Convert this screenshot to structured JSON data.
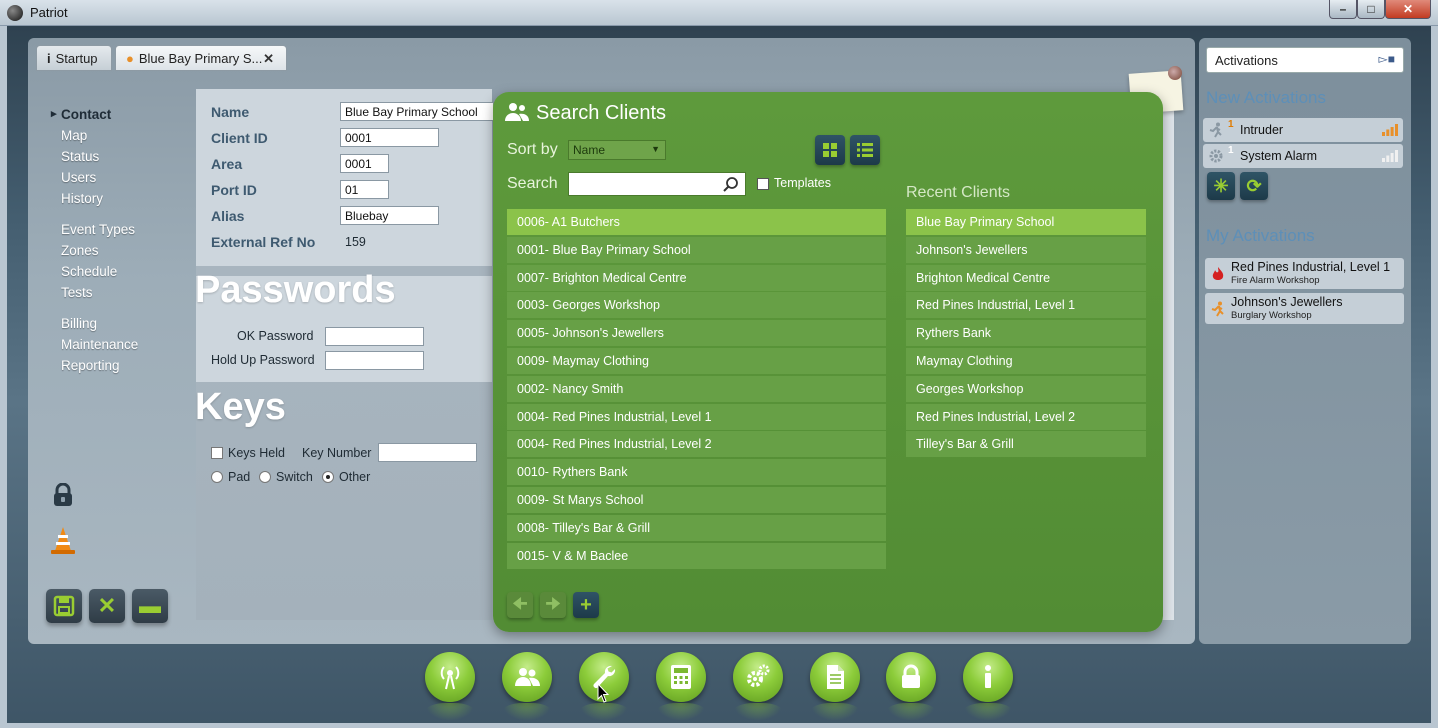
{
  "window": {
    "title": "Patriot",
    "min": "–",
    "max": "□",
    "close": "✕"
  },
  "tabs": [
    {
      "label": "Startup",
      "icon": "info-icon"
    },
    {
      "label": "Blue Bay Primary S...",
      "icon": "user-icon",
      "close": "✕"
    }
  ],
  "nav": {
    "items": [
      "Contact",
      "Map",
      "Status",
      "Users",
      "History",
      "Event Types",
      "Zones",
      "Schedule",
      "Tests",
      "Billing",
      "Maintenance",
      "Reporting"
    ],
    "active": "Contact"
  },
  "client": {
    "name_label": "Name",
    "name_value": "Blue Bay Primary School",
    "id_label": "Client ID",
    "id_value": "0001",
    "area_label": "Area",
    "area_value": "0001",
    "port_label": "Port ID",
    "port_value": "01",
    "alias_label": "Alias",
    "alias_value": "Bluebay",
    "extref_label": "External Ref No",
    "extref_value": "159"
  },
  "passwords": {
    "title": "Passwords",
    "ok_label": "OK Password",
    "holdup_label": "Hold Up Password"
  },
  "keys": {
    "title": "Keys",
    "held_label": "Keys Held",
    "number_label": "Key Number",
    "pad_label": "Pad",
    "switch_label": "Switch",
    "other_label": "Other",
    "selected": "Other"
  },
  "search_clients": {
    "title": "Search Clients",
    "sort_label": "Sort by",
    "sort_value": "Name",
    "search_label": "Search",
    "search_value": "",
    "templates_label": "Templates",
    "results": [
      "0006- A1 Butchers",
      "0001- Blue Bay Primary School",
      "0007- Brighton Medical Centre",
      "0003- Georges Workshop",
      "0005- Johnson's Jewellers",
      "0009- Maymay Clothing",
      "0002- Nancy Smith",
      "0004- Red Pines Industrial, Level 1",
      "0004- Red Pines Industrial, Level 2",
      "0010- Rythers Bank",
      "0009- St Marys School",
      "0008- Tilley's Bar & Grill",
      "0015- V & M Baclee"
    ],
    "selected_result": 0,
    "recent_title": "Recent Clients",
    "recent": [
      "Blue Bay Primary School",
      "Johnson's Jewellers",
      "Brighton Medical Centre",
      "Red Pines Industrial, Level 1",
      "Rythers Bank",
      "Maymay Clothing",
      "Georges Workshop",
      "Red Pines Industrial, Level 2",
      "Tilley's Bar & Grill"
    ],
    "selected_recent": 0
  },
  "activations": {
    "header": "Activations",
    "new_title": "New Activations",
    "new_items": [
      {
        "count": "1",
        "label": "Intruder",
        "icon": "running-person-icon",
        "bar_color": "#e8902a"
      },
      {
        "count": "1",
        "label": "System Alarm",
        "icon": "gear-icon",
        "bar_color": "#f0f0f0"
      }
    ],
    "my_title": "My Activations",
    "my_items": [
      {
        "title": "Red Pines Industrial, Level 1",
        "subtitle": "Fire Alarm Workshop",
        "icon": "fire-icon"
      },
      {
        "title": "Johnson's Jewellers",
        "subtitle": "Burglary Workshop",
        "icon": "running-person-icon"
      }
    ]
  },
  "colors": {
    "accent_green": "#8bc34a",
    "panel_green": "#5e9a3c",
    "heading_blue": "#5d8fb8"
  }
}
